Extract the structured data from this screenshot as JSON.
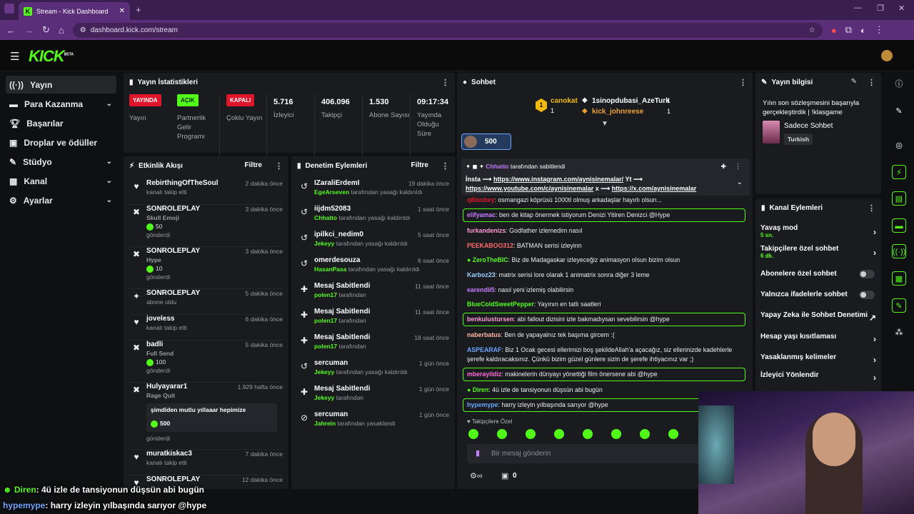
{
  "browser": {
    "tab_title": "Stream - Kick Dashboard",
    "url": "dashboard.kick.com/stream"
  },
  "header": {
    "logo": "KICK",
    "logo_sup": "BETA"
  },
  "sidebar": {
    "items": [
      {
        "label": "Yayın",
        "icon": "broadcast-icon"
      },
      {
        "label": "Para Kazanma",
        "icon": "money-icon"
      },
      {
        "label": "Başarılar",
        "icon": "trophy-icon"
      },
      {
        "label": "Droplar ve ödüller",
        "icon": "gift-icon"
      },
      {
        "label": "Stüdyo",
        "icon": "studio-icon"
      },
      {
        "label": "Kanal",
        "icon": "channel-icon"
      },
      {
        "label": "Ayarlar",
        "icon": "gear-icon"
      }
    ]
  },
  "stats": {
    "title": "Yayın İstatistikleri",
    "items": [
      {
        "badge": "YAYINDA",
        "label": "Yayın",
        "color": "#e0142b"
      },
      {
        "badge": "AÇIK",
        "label": "Partnerlik Gelir Programı",
        "color": "#53fc18"
      },
      {
        "badge": "KAPALI",
        "label": "Çoklu Yayın",
        "color": "#e0142b"
      },
      {
        "value": "5.716",
        "label": "İzleyici"
      },
      {
        "value": "406.096",
        "label": "Takipçi"
      },
      {
        "value": "1.530",
        "label": "Abone Sayısı"
      },
      {
        "value": "09:17:34",
        "label": "Yayında Olduğu Süre"
      }
    ]
  },
  "activity": {
    "title": "Etkinlik Akışı",
    "filter": "Filtre",
    "rows": [
      {
        "name": "RebirthingOfTheSoul",
        "time": "2 dakika önce",
        "sub": "kanalı takip etti"
      },
      {
        "name": "SONROLEPLAY",
        "time": "3 dakika önce",
        "item": "Skull Emoji",
        "amount": "50",
        "sub": "gönderdi"
      },
      {
        "name": "SONROLEPLAY",
        "time": "3 dakika önce",
        "item": "Hype",
        "amount": "10",
        "sub": "gönderdi"
      },
      {
        "name": "SONROLEPLAY",
        "time": "5 dakika önce",
        "sub": "abone oldu"
      },
      {
        "name": "joveless",
        "time": "6 dakika önce",
        "sub": "kanalı takip etti"
      },
      {
        "name": "badli",
        "time": "5 dakika önce",
        "item": "Full Send",
        "amount": "100",
        "sub": "gönderdi"
      },
      {
        "name": "Hulyayarar1",
        "time": "1.929 hafta önce",
        "item": "Rage Quit",
        "message": "şimdiden mutlu yıllaaar hepimize",
        "amount": "500",
        "sub": "gönderdi"
      },
      {
        "name": "muratkiskac3",
        "time": "7 dakika önce",
        "sub": "kanalı takip etti"
      },
      {
        "name": "SONROLEPLAY",
        "time": "12 dakika önce",
        "sub": ""
      }
    ]
  },
  "moderation": {
    "title": "Denetim Eylemleri",
    "filter": "Filtre",
    "rows": [
      {
        "name": "IZaraliErdemI",
        "time": "19 dakika önce",
        "actor": "EgeArseven",
        "sub": "tarafından yasağı kaldırıldı"
      },
      {
        "name": "iijdm52083",
        "time": "1 saat önce",
        "actor": "Chhatto",
        "sub": "tarafından yasağı kaldırıldı"
      },
      {
        "name": "ipilkci_nedim0",
        "time": "5 saat önce",
        "actor": "Jekeyy",
        "sub": "tarafından yasağı kaldırıldı"
      },
      {
        "name": "omerdesouza",
        "time": "6 saat önce",
        "actor": "HasanPasa",
        "sub": "tarafından yasağı kaldırıldı"
      },
      {
        "name": "Mesaj Sabitlendi",
        "time": "11 saat önce",
        "actor": "polen17",
        "sub": "tarafından"
      },
      {
        "name": "Mesaj Sabitlendi",
        "time": "11 saat önce",
        "actor": "polen17",
        "sub": "tarafından"
      },
      {
        "name": "Mesaj Sabitlendi",
        "time": "18 saat önce",
        "actor": "polen17",
        "sub": "tarafından"
      },
      {
        "name": "sercuman",
        "time": "1 gün önce",
        "actor": "Jekeyy",
        "sub": "tarafından yasağı kaldırıldı"
      },
      {
        "name": "Mesaj Sabitlendi",
        "time": "1 gün önce",
        "actor": "Jekeyy",
        "sub": "tarafından"
      },
      {
        "name": "sercuman",
        "time": "1 gün önce",
        "actor": "Jahrein",
        "sub": "tarafından yasaklandı"
      }
    ]
  },
  "chat": {
    "title": "Sohbet",
    "leader": {
      "name": "canokat",
      "rank": "1",
      "count": "1"
    },
    "gifters": [
      {
        "name": "1sinopdubasi_AzeTurk",
        "count": "1"
      },
      {
        "name": "kick_johnreese",
        "count": "1"
      }
    ],
    "goal": "500",
    "pinned": {
      "by": "Chhatto",
      "by_suffix": "tarafından sabitlendi",
      "text1": "İnsta ⟶",
      "link1": "https://www.instagram.com/aynisinemalar/",
      "text2": "Yt ⟶",
      "link2": "https://www.youtube.com/c/aynisinemalar",
      "text3": "x ⟶",
      "link3": "https://x.com/aynisinemalar"
    },
    "messages": [
      {
        "user": "q8ibobey",
        "color": "#e0142b",
        "text": "osmangazi köprüsü 1000tl olmuş arkadaşlar hayırlı olsun..."
      },
      {
        "user": "elifyamac",
        "color": "#c77dff",
        "text": "ben de kitap önermek istiyorum Denizi Yitiren Denizci @Hype",
        "hl": true
      },
      {
        "user": "furkandenizs",
        "color": "#ff9ad5",
        "text": "Godfather izlemedim nasıl"
      },
      {
        "user": "PEEKABOO312",
        "color": "#ff6b6b",
        "text": "BATMAN serisi izleyinn"
      },
      {
        "user": "ZeroTheBIC",
        "color": "#53fc18",
        "text": "Biz de Madagaskar izleyeceğiz animasyon olsun bizim olsun"
      },
      {
        "user": "Karboz23",
        "color": "#9ad0ff",
        "text": "matrix serisi lore olarak 1 animatrix sonra diğer 3 leme"
      },
      {
        "user": "earendil5",
        "color": "#c77dff",
        "text": "nasıl yeni izlemiş olabilirsin"
      },
      {
        "user": "BlueColdSweetPepper",
        "color": "#53fc18",
        "text": "Yayının en tatlı saatleri"
      },
      {
        "user": "benkulustursen",
        "color": "#ff9ad5",
        "text": "abi fallout dizisini izle bakmadıysan sevebilirsin @hype",
        "hl": true
      },
      {
        "user": "naberbatus",
        "color": "#ffb4a2",
        "text": "Ben de yapayalnız tek başıma gircem :("
      },
      {
        "user": "ASPEARAF",
        "color": "#6ca6ff",
        "text": "Biz 1 Ocak gecesi ellerimizi boş şekildeAllah'a açacağız, siz ellerinizde kadehlerle şerefe kaldıracaksınız. Çünkü bizim güzel günlere sizin de şerefe ihtiyacınız var ;)"
      },
      {
        "user": "mberayildiz",
        "color": "#ff6bd6",
        "text": "makinelerin dünyayı yönettiği film önersene abi @hype",
        "hl": true
      },
      {
        "user": "Diren",
        "color": "#53fc18",
        "text": "4ü izle de tansiyonun düşsün abi bugün"
      },
      {
        "user": "hypemype",
        "color": "#6ca6ff",
        "text": "harry izleyin yılbaşında sarıyor @hype",
        "hl": true
      }
    ],
    "emote_label": "Takipçilere Özel",
    "input_placeholder": "Bir mesaj gönderin",
    "points": "0"
  },
  "stream_info": {
    "title": "Yayın bilgisi",
    "stream_title": "Yılın son sözleşmesini başarıyla gerçekleştirdik | !klasgame",
    "category": "Sadece Sohbet",
    "language": "Turkish"
  },
  "channel_actions": {
    "title": "Kanal Eylemleri",
    "items": [
      {
        "label": "Yavaş mod",
        "sub": "5 sn.",
        "type": "arrow"
      },
      {
        "label": "Takipçilere özel sohbet",
        "sub": "6 dk.",
        "type": "arrow"
      },
      {
        "label": "Abonelere özel sohbet",
        "type": "toggle"
      },
      {
        "label": "Yalnızca ifadelerle sohbet",
        "type": "toggle"
      },
      {
        "label": "Yapay Zeka ile Sohbet Denetimi",
        "type": "external"
      },
      {
        "label": "Hesap yaşı kısıtlaması",
        "type": "arrow"
      },
      {
        "label": "Yasaklanmış kelimeler",
        "type": "arrow"
      },
      {
        "label": "İzleyici Yönlendir",
        "type": "arrow"
      }
    ]
  },
  "overlay": {
    "line1_user": "Diren",
    "line1_text": ": 4ü izle de tansiyonun düşsün abi bugün",
    "line2_user": "hypemype",
    "line2_text": ": harry izleyin yılbaşında sarıyor @hype"
  },
  "colors": {
    "accent": "#53fc18",
    "live": "#e0142b",
    "browser": "#5b2e7a"
  }
}
